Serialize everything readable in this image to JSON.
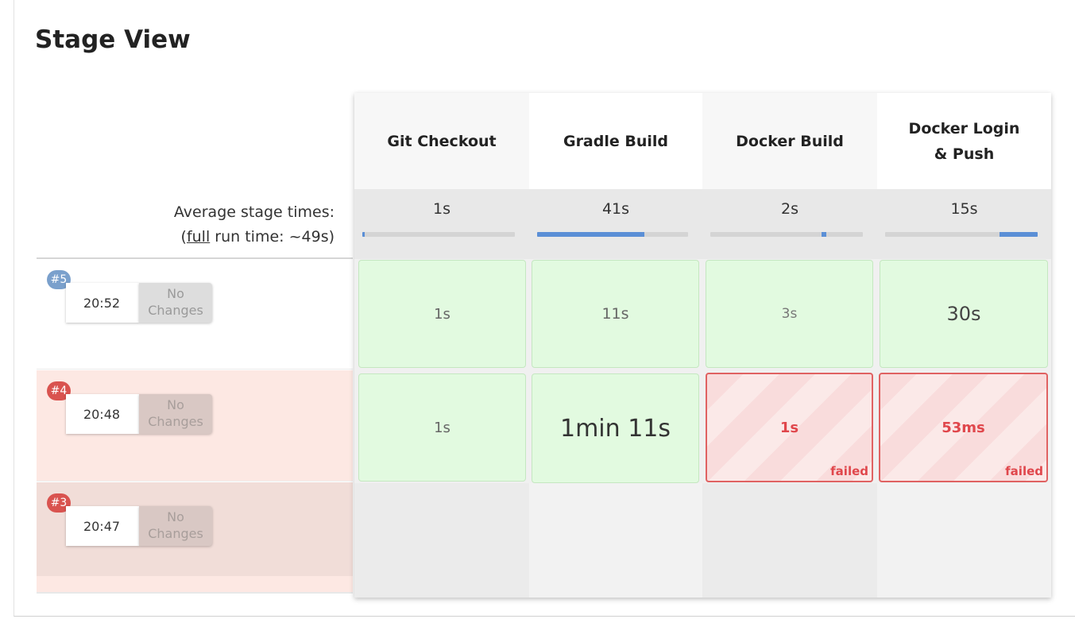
{
  "page": {
    "title": "Stage View"
  },
  "summary": {
    "avg_label": "Average stage times:",
    "full_link": "full",
    "full_run_prefix": "(",
    "full_run_suffix": " run time: ~49s)"
  },
  "stages": [
    {
      "name": "Git Checkout",
      "avg": "1s",
      "bar_fill_start": 0.0,
      "bar_fill_end": 0.01
    },
    {
      "name": "Gradle Build",
      "avg": "41s",
      "bar_fill_start": 0.0,
      "bar_fill_end": 0.71
    },
    {
      "name": "Docker Build",
      "avg": "2s",
      "bar_fill_start": 0.73,
      "bar_fill_end": 0.76
    },
    {
      "name": "Docker Login\n& Push",
      "avg": "15s",
      "bar_fill_start": 0.75,
      "bar_fill_end": 1.0
    }
  ],
  "runs": [
    {
      "id": "#5",
      "time": "20:52",
      "changes_line1": "No",
      "changes_line2": "Changes",
      "status": "success",
      "cells": [
        "1s",
        "11s",
        "3s",
        "30s"
      ]
    },
    {
      "id": "#4",
      "time": "20:48",
      "changes_line1": "No",
      "changes_line2": "Changes",
      "status": "failed",
      "cells": [
        "1s",
        "1min 11s",
        "1s",
        "53ms"
      ],
      "failed_label": "failed"
    },
    {
      "id": "#3",
      "time": "20:47",
      "changes_line1": "No",
      "changes_line2": "Changes",
      "status": "failed",
      "cells": []
    }
  ],
  "colors": {
    "success": "#e2fae0",
    "failed_border": "#e06262",
    "bar": "#5b8fd6",
    "badge_blue": "#7aa0cc",
    "badge_red": "#d9534f"
  }
}
